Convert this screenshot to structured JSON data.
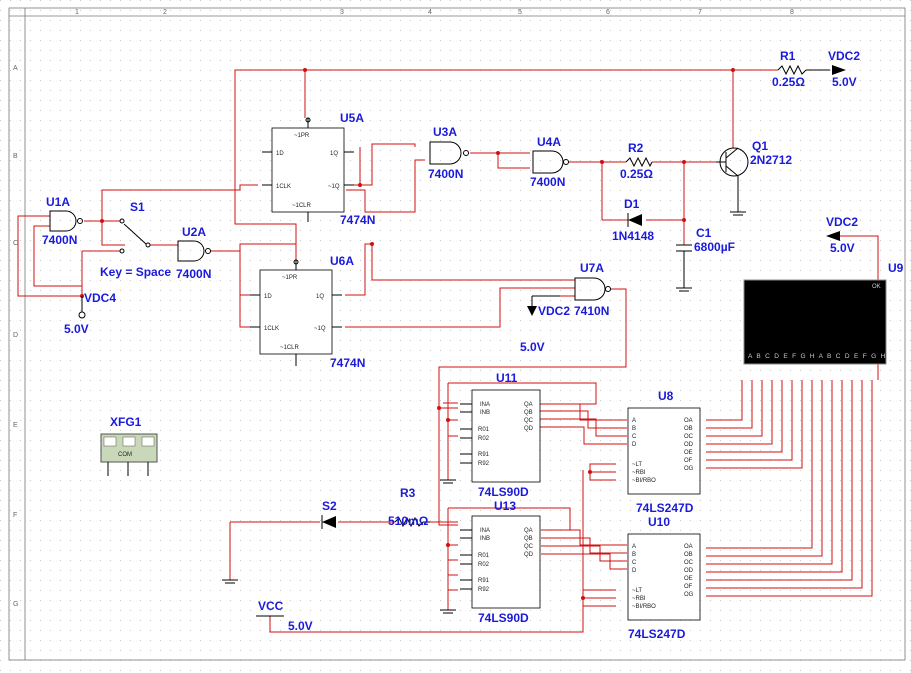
{
  "ruler": {
    "top": [
      "1",
      "2",
      "3",
      "4",
      "5",
      "6",
      "7",
      "8"
    ],
    "left": [
      "A",
      "B",
      "C",
      "D",
      "E",
      "F",
      "G"
    ]
  },
  "components": {
    "U1A": {
      "ref": "U1A",
      "type": "7400N"
    },
    "U2A": {
      "ref": "U2A",
      "type": "7400N"
    },
    "U3A": {
      "ref": "U3A",
      "type": "7400N"
    },
    "U4A": {
      "ref": "U4A",
      "type": "7400N"
    },
    "U5A": {
      "ref": "U5A",
      "type": "7474N"
    },
    "U6A": {
      "ref": "U6A",
      "type": "7474N"
    },
    "U7A": {
      "ref": "U7A",
      "type": "7410N"
    },
    "S1": {
      "ref": "S1",
      "key": "Key = Space"
    },
    "S2": {
      "ref": "S2"
    },
    "R1": {
      "ref": "R1",
      "value": "0.25Ω"
    },
    "R2": {
      "ref": "R2",
      "value": "0.25Ω"
    },
    "R3": {
      "ref": "R3",
      "value": "510mΩ"
    },
    "C1": {
      "ref": "C1",
      "value": "6800µF"
    },
    "D1": {
      "ref": "D1",
      "type": "1N4148"
    },
    "Q1": {
      "ref": "Q1",
      "type": "2N2712"
    },
    "U11": {
      "ref": "U11",
      "type": "74LS90D"
    },
    "U13": {
      "ref": "U13",
      "type": "74LS90D"
    },
    "U8": {
      "ref": "U8",
      "type": "74LS247D"
    },
    "U10": {
      "ref": "U10",
      "type": "74LS247D"
    },
    "U9": {
      "ref": "U9",
      "ok": "OK",
      "pins": "A B C D E F G H A B C D E F G H"
    },
    "XFG1": {
      "ref": "XFG1",
      "com": "COM"
    }
  },
  "sources": {
    "vdc2_top": {
      "name": "VDC2",
      "value": "5.0V"
    },
    "vdc2_right": {
      "name": "VDC2",
      "value": "5.0V"
    },
    "vdc2_mid": {
      "name": "VDC2",
      "value": "5.0V"
    },
    "vdc4": {
      "name": "VDC4",
      "value": "5.0V"
    },
    "vcc": {
      "name": "VCC",
      "value": "5.0V"
    }
  },
  "ff_pins": {
    "pr": "~1PR",
    "d": "1D",
    "clk": "1CLK",
    "q": "1Q",
    "qn": "~1Q",
    "clr": "~1CLR"
  },
  "counter_pins": {
    "inA": "INA",
    "inB": "INB",
    "r01": "R01",
    "r02": "R02",
    "r91": "R91",
    "r92": "R92",
    "qa": "QA",
    "qb": "QB",
    "qc": "QC",
    "qd": "QD"
  },
  "decoder_pins": {
    "a": "A",
    "b": "B",
    "c": "C",
    "d": "D",
    "lt": "~LT",
    "rbi": "~RBI",
    "bi": "~BI/RBO",
    "oa": "OA",
    "ob": "OB",
    "oc": "OC",
    "od": "OD",
    "oe": "OE",
    "of": "OF",
    "og": "OG"
  },
  "colors": {
    "wire": "#d01010",
    "label": "#1a1adc",
    "grid": "#c8c8c8",
    "display": "#000000"
  }
}
